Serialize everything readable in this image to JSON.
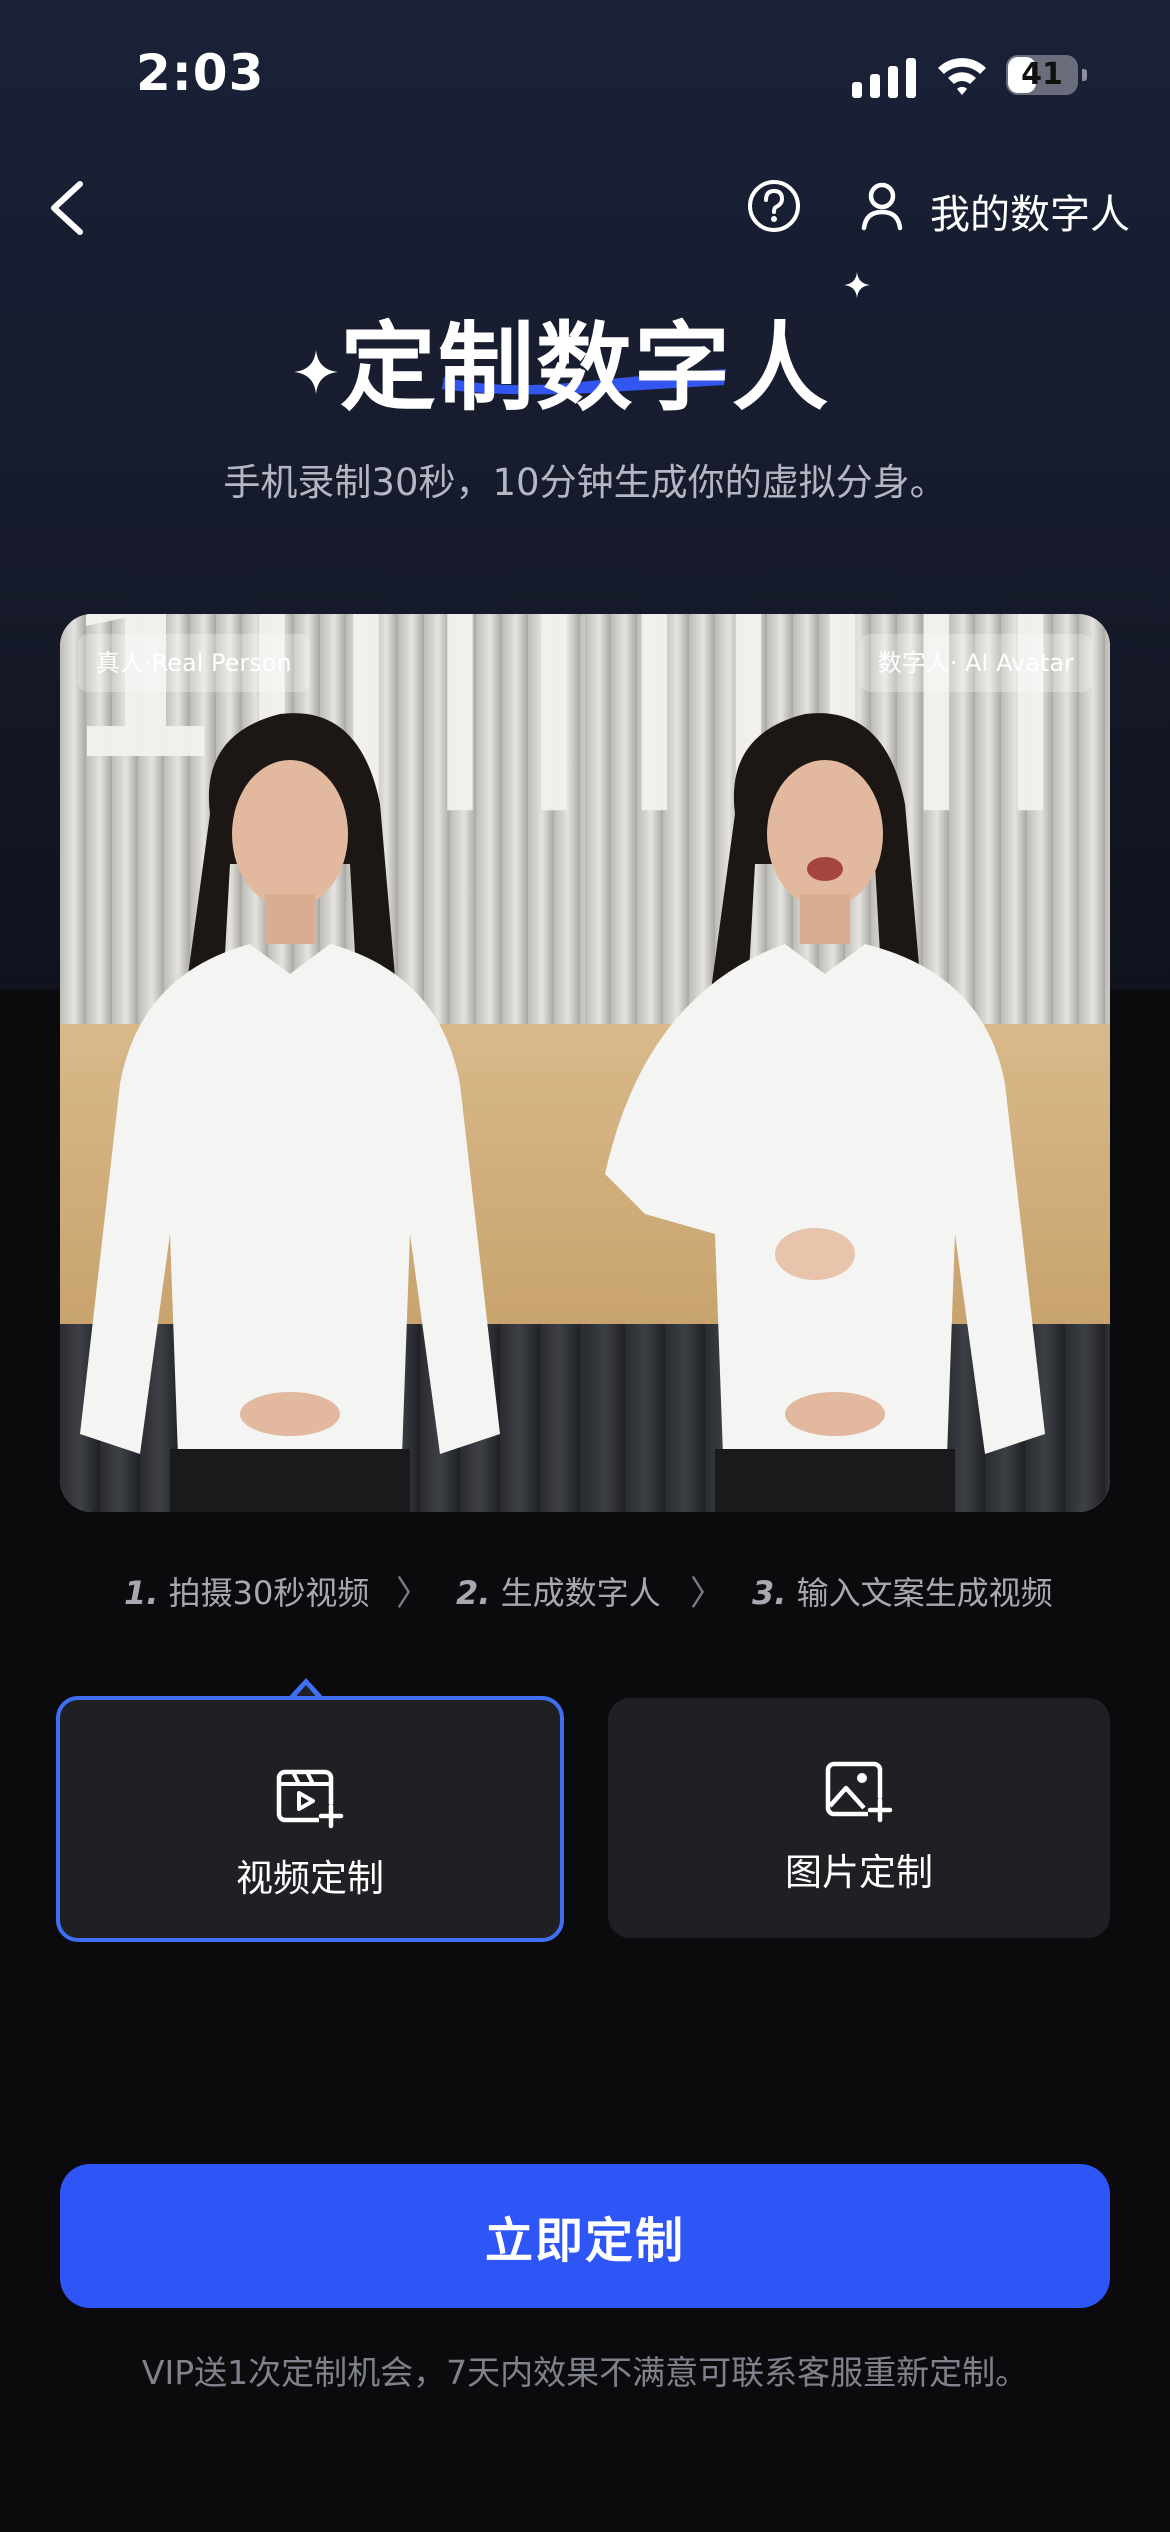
{
  "status_bar": {
    "time": "2:03",
    "battery": "41",
    "battery_level": 0.41
  },
  "nav": {
    "my_digital_human": "我的数字人"
  },
  "header": {
    "title": "定制数字人",
    "subtitle": "手机录制30秒，10分钟生成你的虚拟分身。"
  },
  "preview": {
    "left_tag": "真人·Real Person",
    "right_tag": "数字人· AI Avatar"
  },
  "steps": [
    {
      "num": "1.",
      "text": "拍摄30秒视频"
    },
    {
      "num": "2.",
      "text": "生成数字人"
    },
    {
      "num": "3.",
      "text": "输入文案生成视频"
    }
  ],
  "step_separator": "〉",
  "options": [
    {
      "label": "视频定制",
      "selected": true
    },
    {
      "label": "图片定制",
      "selected": false
    }
  ],
  "cta": {
    "label": "立即定制"
  },
  "footer_note": "VIP送1次定制机会，7天内效果不满意可联系客服重新定制。",
  "colors": {
    "accent": "#3f6ff5",
    "cta": "#2e55f5",
    "background": "#0b0b0d"
  }
}
